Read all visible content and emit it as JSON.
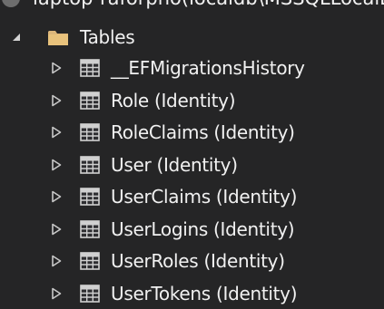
{
  "tree": {
    "connection_label": "laptop-raforpno(localdb\\MSSQLLocalDB, RAFO",
    "folder": {
      "label": "Tables",
      "expanded": true,
      "icon": "folder-icon"
    },
    "tables": [
      {
        "label": "__EFMigrationsHistory",
        "expanded": false,
        "icon": "table-icon"
      },
      {
        "label": "Role (Identity)",
        "expanded": false,
        "icon": "table-icon"
      },
      {
        "label": "RoleClaims (Identity)",
        "expanded": false,
        "icon": "table-icon"
      },
      {
        "label": "User (Identity)",
        "expanded": false,
        "icon": "table-icon"
      },
      {
        "label": "UserClaims (Identity)",
        "expanded": false,
        "icon": "table-icon"
      },
      {
        "label": "UserLogins (Identity)",
        "expanded": false,
        "icon": "table-icon"
      },
      {
        "label": "UserRoles (Identity)",
        "expanded": false,
        "icon": "table-icon"
      },
      {
        "label": "UserTokens (Identity)",
        "expanded": false,
        "icon": "table-icon"
      }
    ],
    "colors": {
      "background": "#252526",
      "text": "#f1f1f1",
      "folder": "#dcb67a",
      "expander": "#c8c8c8"
    }
  }
}
